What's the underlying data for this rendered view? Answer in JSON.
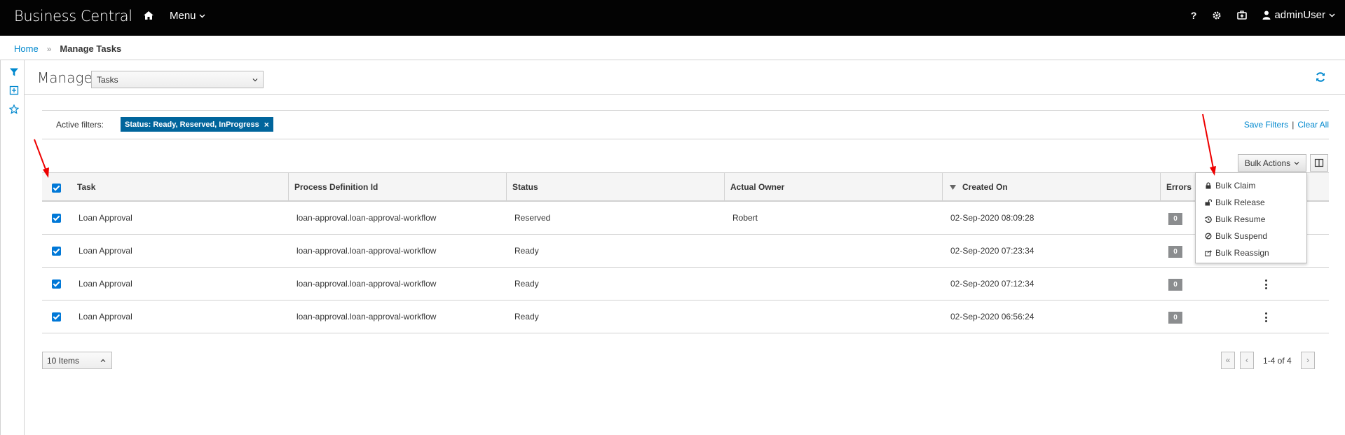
{
  "app": {
    "brand": "Business Central",
    "menu_label": "Menu",
    "user": "adminUser",
    "help_label": "?"
  },
  "breadcrumb": {
    "home": "Home",
    "separator": "»",
    "current": "Manage Tasks"
  },
  "manage": {
    "title": "Manage",
    "selected": "Tasks"
  },
  "filters": {
    "label": "Active filters:",
    "chip": "Status: Ready, Reserved, InProgress",
    "chip_close": "×",
    "save": "Save Filters",
    "divider": "|",
    "clear": "Clear All"
  },
  "toolbar": {
    "bulk_actions": "Bulk Actions"
  },
  "table": {
    "columns": [
      "Task",
      "Process Definition Id",
      "Status",
      "Actual Owner",
      "Created On",
      "Errors"
    ],
    "rows": [
      {
        "task": "Loan Approval",
        "process": "loan-approval.loan-approval-workflow",
        "status": "Reserved",
        "owner": "Robert",
        "created": "02-Sep-2020 08:09:28",
        "errors": "0"
      },
      {
        "task": "Loan Approval",
        "process": "loan-approval.loan-approval-workflow",
        "status": "Ready",
        "owner": "",
        "created": "02-Sep-2020 07:23:34",
        "errors": "0"
      },
      {
        "task": "Loan Approval",
        "process": "loan-approval.loan-approval-workflow",
        "status": "Ready",
        "owner": "",
        "created": "02-Sep-2020 07:12:34",
        "errors": "0"
      },
      {
        "task": "Loan Approval",
        "process": "loan-approval.loan-approval-workflow",
        "status": "Ready",
        "owner": "",
        "created": "02-Sep-2020 06:56:24",
        "errors": "0"
      }
    ]
  },
  "bulk_menu": [
    "Bulk Claim",
    "Bulk Release",
    "Bulk Resume",
    "Bulk Suspend",
    "Bulk Reassign"
  ],
  "footer": {
    "items": "10 Items",
    "range": "1-4 of 4",
    "first": "«",
    "prev": "‹",
    "next": "›"
  },
  "colors": {
    "topbar": "#030303",
    "link": "#0088ce",
    "chip": "#00659c",
    "arrow": "#ee0000",
    "checkbox": "#0078d7"
  }
}
